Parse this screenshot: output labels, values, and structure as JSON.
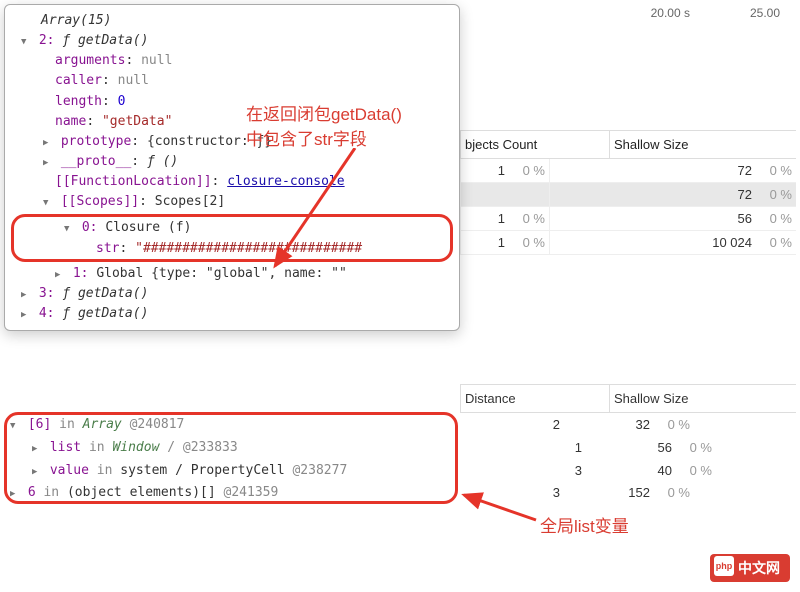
{
  "timeline": {
    "t1": "20.00 s",
    "t2": "25.00"
  },
  "tooltip": {
    "title": "Array(15)",
    "entry2": {
      "idx": "2",
      "name": "getData",
      "callee": "()",
      "args_label": "arguments",
      "args_val": "null",
      "caller_label": "caller",
      "caller_val": "null",
      "length_label": "length",
      "length_val": "0",
      "name_label": "name",
      "name_val": "\"getData\"",
      "proto_label": "prototype",
      "proto_val": "{constructor: ƒ}",
      "dunder_label": "__proto__",
      "dunder_val": "ƒ ()",
      "funcloc_label": "[[FunctionLocation]]",
      "funcloc_val": "closure-console",
      "scopes_label": "[[Scopes]]",
      "scopes_val": "Scopes[2]",
      "closure_label": "0",
      "closure_name": "Closure (f)",
      "str_label": "str",
      "str_val": "\"############################",
      "global_label": "1",
      "global_val": "Global {type: \"global\", name: \"\""
    },
    "entry3": {
      "idx": "3",
      "name": "getData",
      "callee": "()"
    },
    "entry4": {
      "idx": "4",
      "name": "getData",
      "callee": "()"
    }
  },
  "table1": {
    "col1": "bjects Count",
    "col2": "Shallow Size",
    "rows": [
      {
        "count": "1",
        "cpct": "0 %",
        "size": "72",
        "spct": "0 %",
        "sel": false
      },
      {
        "count": "",
        "cpct": "",
        "size": "72",
        "spct": "0 %",
        "sel": true
      },
      {
        "count": "1",
        "cpct": "0 %",
        "size": "56",
        "spct": "0 %",
        "sel": false
      },
      {
        "count": "1",
        "cpct": "0 %",
        "size": "10 024",
        "spct": "0 %",
        "sel": false
      }
    ]
  },
  "table2": {
    "col1": "Distance",
    "col2": "Shallow Size"
  },
  "retainers": {
    "r0": {
      "idx": "[6]",
      "in": "in",
      "obj": "Array",
      "addr": "@240817",
      "dist": "2",
      "shallow": "32",
      "pct": "0 %"
    },
    "r1": {
      "idx": "list",
      "in": "in",
      "obj": "Window",
      "sep": "/",
      "addr": "@233833",
      "dist": "1",
      "shallow": "56",
      "pct": "0 %"
    },
    "r2": {
      "idx": "value",
      "in": "in",
      "plain": "system / PropertyCell",
      "addr": "@238277",
      "dist": "3",
      "shallow": "40",
      "pct": "0 %"
    },
    "r3": {
      "idx": "6",
      "in": "in",
      "plain": "(object elements)[]",
      "addr": "@241359",
      "dist": "3",
      "shallow": "152",
      "pct": "0 %"
    }
  },
  "annotations": {
    "a1_line1": "在返回闭包getData()",
    "a1_line2": "中包含了str字段",
    "a2": "全局list变量"
  },
  "watermark": "中文网"
}
